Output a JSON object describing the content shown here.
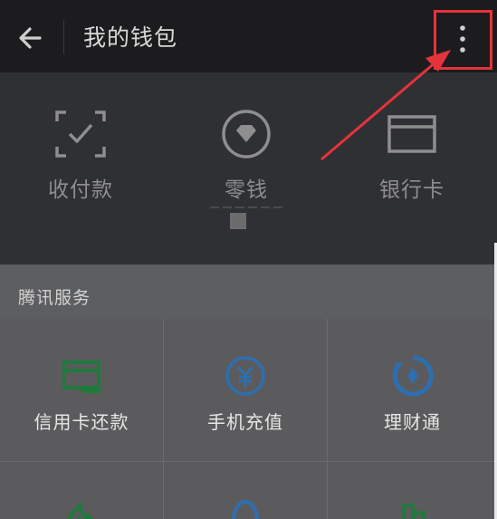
{
  "header": {
    "title": "我的钱包",
    "back_icon": "arrow-left-icon",
    "more_icon": "more-vertical-icon"
  },
  "wallet": {
    "items": [
      {
        "label": "收付款",
        "icon": "scan-pay-icon"
      },
      {
        "label": "零钱",
        "icon": "change-diamond-icon"
      },
      {
        "label": "银行卡",
        "icon": "bank-card-icon"
      }
    ]
  },
  "services": {
    "title": "腾讯服务",
    "items": [
      {
        "label": "信用卡还款",
        "icon": "credit-card-repay-icon"
      },
      {
        "label": "手机充值",
        "icon": "yuan-coin-icon"
      },
      {
        "label": "理财通",
        "icon": "wealth-icon"
      },
      {
        "label": "",
        "icon": "flame-icon"
      },
      {
        "label": "",
        "icon": "qq-icon"
      },
      {
        "label": "",
        "icon": "city-icon"
      }
    ]
  },
  "colors": {
    "header_bg": "#1c1c1e",
    "wallet_bg": "#2e3033",
    "services_bg": "#5b5b5d",
    "accent_green": "#1f7a3c",
    "accent_blue": "#2d6fb0",
    "annotation_red": "#e5333b"
  }
}
